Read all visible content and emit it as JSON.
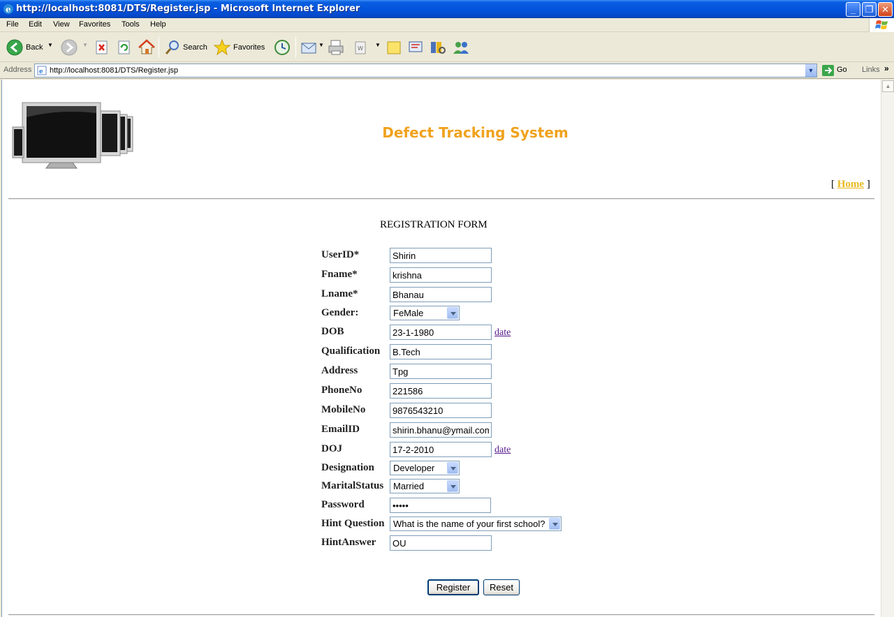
{
  "window": {
    "title": "http://localhost:8081/DTS/Register.jsp - Microsoft Internet Explorer"
  },
  "menu": [
    "File",
    "Edit",
    "View",
    "Favorites",
    "Tools",
    "Help"
  ],
  "toolbar": {
    "back_label": "Back",
    "search_label": "Search",
    "favorites_label": "Favorites"
  },
  "address": {
    "label": "Address",
    "url": "http://localhost:8081/DTS/Register.jsp",
    "go_label": "Go",
    "links_label": "Links"
  },
  "page": {
    "title": "Defect Tracking System",
    "home_open": "[",
    "home_label": "Home",
    "home_close": "]",
    "form_heading": "REGISTRATION FORM"
  },
  "form": {
    "userid": {
      "label": "UserID*",
      "value": "Shirin"
    },
    "fname": {
      "label": "Fname*",
      "value": "krishna"
    },
    "lname": {
      "label": "Lname*",
      "value": "Bhanau"
    },
    "gender": {
      "label": "Gender:",
      "value": "FeMale"
    },
    "dob": {
      "label": "DOB",
      "value": "23-1-1980",
      "link": "date"
    },
    "qualification": {
      "label": "Qualification",
      "value": "B.Tech"
    },
    "address": {
      "label": "Address",
      "value": "Tpg"
    },
    "phone": {
      "label": "PhoneNo",
      "value": "221586"
    },
    "mobile": {
      "label": "MobileNo",
      "value": "9876543210"
    },
    "email": {
      "label": "EmailID",
      "value": "shirin.bhanu@ymail.com"
    },
    "doj": {
      "label": "DOJ",
      "value": "17-2-2010",
      "link": "date"
    },
    "designation": {
      "label": "Designation",
      "value": "Developer"
    },
    "marital": {
      "label": "MaritalStatus",
      "value": "Married"
    },
    "password": {
      "label": "Password",
      "value": "ooooo"
    },
    "hintq": {
      "label": "Hint Question",
      "value": "What is the name of your first school?"
    },
    "hinta": {
      "label": "HintAnswer",
      "value": "OU"
    }
  },
  "buttons": {
    "register": "Register",
    "reset": "Reset"
  },
  "colors": {
    "title_orange": "#f0a21e",
    "home_gold": "#e8b81c",
    "titlebar_blue": "#0454de"
  }
}
